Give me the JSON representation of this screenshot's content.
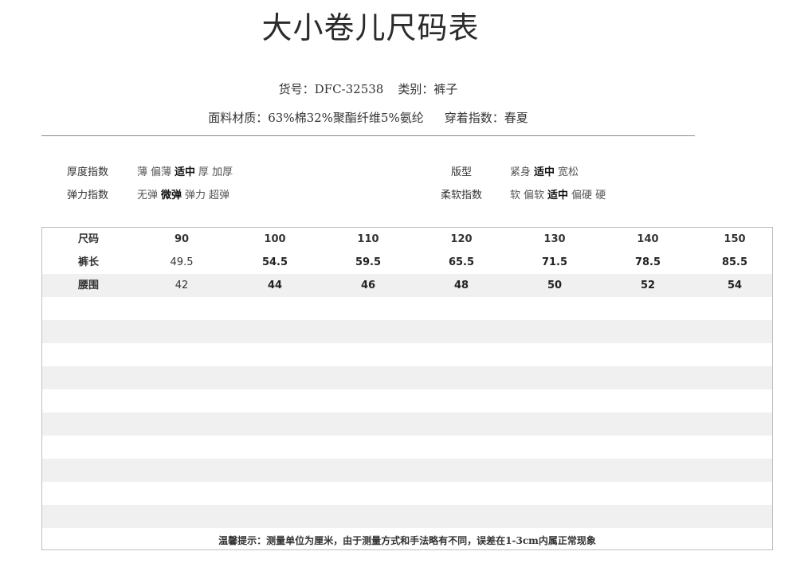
{
  "title": "大小卷儿尺码表",
  "product": {
    "item_no_label": "货号：",
    "item_no": "DFC-32538",
    "category_label": "类别：",
    "category": "裤子",
    "fabric_label": "面料材质：",
    "fabric": "63%棉32%聚酯纤维5%氨纶",
    "season_label": "穿着指数：",
    "season": "春夏"
  },
  "attributes": {
    "thickness": {
      "label": "厚度指数",
      "options": [
        "薄",
        "偏薄",
        "适中",
        "厚",
        "加厚"
      ],
      "selected": "适中"
    },
    "fit": {
      "label": "版型",
      "options": [
        "紧身",
        "适中",
        "宽松"
      ],
      "selected": "适中"
    },
    "elasticity": {
      "label": "弹力指数",
      "options": [
        "无弹",
        "微弹",
        "弹力",
        "超弹"
      ],
      "selected": "微弹"
    },
    "softness": {
      "label": "柔软指数",
      "options": [
        "软",
        "偏软",
        "适中",
        "偏硬",
        "硬"
      ],
      "selected": "适中"
    }
  },
  "size_table": {
    "header": [
      "尺码",
      "90",
      "100",
      "110",
      "120",
      "130",
      "140",
      "150"
    ],
    "rows": [
      [
        "裤长",
        "49.5",
        "54.5",
        "59.5",
        "65.5",
        "71.5",
        "78.5",
        "85.5"
      ],
      [
        "腰围",
        "42",
        "44",
        "46",
        "48",
        "50",
        "52",
        "54"
      ]
    ]
  },
  "tip": "温馨提示：测量单位为厘米，由于测量方式和手法略有不同，误差在1-3cm内属正常现象"
}
